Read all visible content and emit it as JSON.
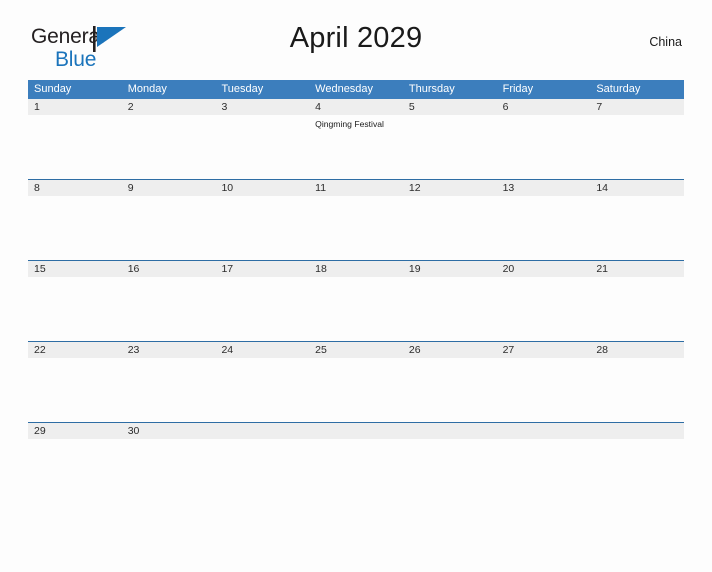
{
  "brand": {
    "name_part1": "General",
    "name_part2": "Blue",
    "flag_icon": "triangle-flag-icon",
    "accent_color": "#1b74bb"
  },
  "header": {
    "title": "April 2029",
    "country": "China"
  },
  "calendar": {
    "header_bg": "#3c7ebd",
    "daterow_bg": "#eeeeee",
    "rule_color": "#2e6da4",
    "weekdays": [
      "Sunday",
      "Monday",
      "Tuesday",
      "Wednesday",
      "Thursday",
      "Friday",
      "Saturday"
    ],
    "weeks": [
      [
        {
          "day": "1",
          "events": []
        },
        {
          "day": "2",
          "events": []
        },
        {
          "day": "3",
          "events": []
        },
        {
          "day": "4",
          "events": [
            "Qingming Festival"
          ]
        },
        {
          "day": "5",
          "events": []
        },
        {
          "day": "6",
          "events": []
        },
        {
          "day": "7",
          "events": []
        }
      ],
      [
        {
          "day": "8",
          "events": []
        },
        {
          "day": "9",
          "events": []
        },
        {
          "day": "10",
          "events": []
        },
        {
          "day": "11",
          "events": []
        },
        {
          "day": "12",
          "events": []
        },
        {
          "day": "13",
          "events": []
        },
        {
          "day": "14",
          "events": []
        }
      ],
      [
        {
          "day": "15",
          "events": []
        },
        {
          "day": "16",
          "events": []
        },
        {
          "day": "17",
          "events": []
        },
        {
          "day": "18",
          "events": []
        },
        {
          "day": "19",
          "events": []
        },
        {
          "day": "20",
          "events": []
        },
        {
          "day": "21",
          "events": []
        }
      ],
      [
        {
          "day": "22",
          "events": []
        },
        {
          "day": "23",
          "events": []
        },
        {
          "day": "24",
          "events": []
        },
        {
          "day": "25",
          "events": []
        },
        {
          "day": "26",
          "events": []
        },
        {
          "day": "27",
          "events": []
        },
        {
          "day": "28",
          "events": []
        }
      ],
      [
        {
          "day": "29",
          "events": []
        },
        {
          "day": "30",
          "events": []
        },
        {
          "day": "",
          "events": []
        },
        {
          "day": "",
          "events": []
        },
        {
          "day": "",
          "events": []
        },
        {
          "day": "",
          "events": []
        },
        {
          "day": "",
          "events": []
        }
      ]
    ]
  }
}
